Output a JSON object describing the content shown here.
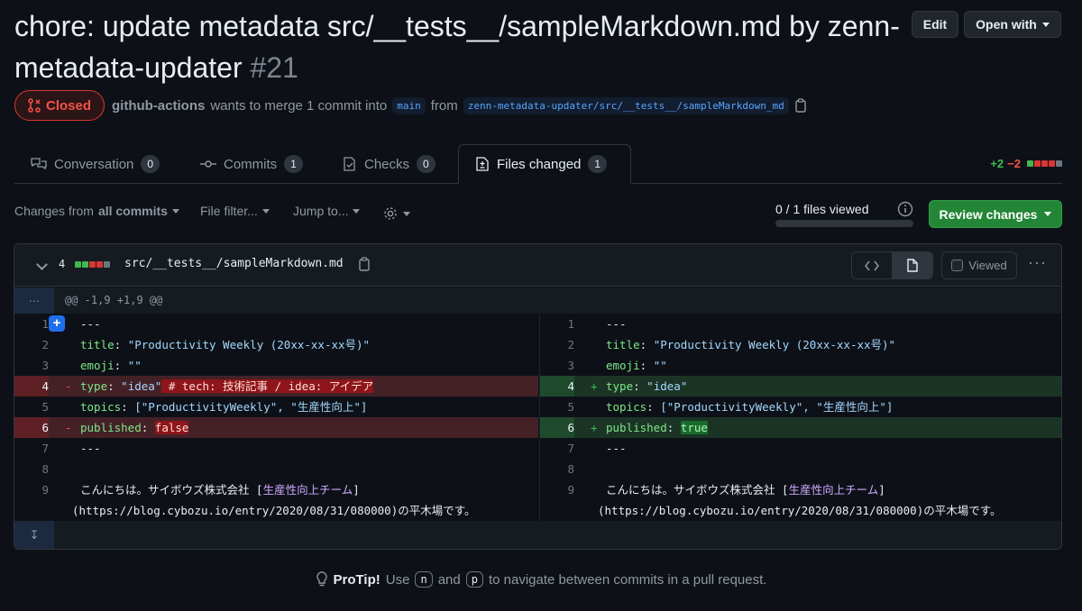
{
  "pr": {
    "title": "chore: update metadata src/__tests__/sampleMarkdown.md by zenn-metadata-updater",
    "number": "#21",
    "state": "Closed",
    "author": "github-actions",
    "merge_text": "wants to merge 1 commit into",
    "base_branch": "main",
    "from_text": "from",
    "head_branch": "zenn-metadata-updater/src/__tests__/sampleMarkdown_md"
  },
  "header_buttons": {
    "edit": "Edit",
    "open_with": "Open with"
  },
  "tabs": [
    {
      "label": "Conversation",
      "count": "0"
    },
    {
      "label": "Commits",
      "count": "1"
    },
    {
      "label": "Checks",
      "count": "0"
    },
    {
      "label": "Files changed",
      "count": "1"
    }
  ],
  "diffstat": {
    "additions": "+2",
    "deletions": "−2",
    "squares": [
      "green",
      "red",
      "red",
      "red",
      "grey"
    ]
  },
  "toolbar": {
    "changes_from_prefix": "Changes from",
    "changes_from_value": "all commits",
    "file_filter": "File filter...",
    "jump_to": "Jump to...",
    "viewed_count": "0 / 1 files viewed",
    "viewed_fraction": 0,
    "review_button": "Review changes"
  },
  "file": {
    "change_count": "4",
    "squares": [
      "green",
      "green",
      "red",
      "red",
      "grey"
    ],
    "path": "src/__tests__/sampleMarkdown.md",
    "viewed_label": "Viewed",
    "hunk_header": "@@ -1,9 +1,9 @@"
  },
  "diff": {
    "left": [
      {
        "ln": "1",
        "prefix": " ",
        "text": "---"
      },
      {
        "ln": "2",
        "prefix": " ",
        "key": "title",
        "value": "\"Productivity Weekly (20xx-xx-xx号)\""
      },
      {
        "ln": "3",
        "prefix": " ",
        "key": "emoji",
        "value": "\"\""
      },
      {
        "ln": "4",
        "prefix": "-",
        "key": "type",
        "value": "\"idea\"",
        "extra": " # tech: 技術記事 / idea: アイデア"
      },
      {
        "ln": "5",
        "prefix": " ",
        "key": "topics",
        "value": "[\"ProductivityWeekly\", \"生産性向上\"]"
      },
      {
        "ln": "6",
        "prefix": "-",
        "key": "published",
        "value": "false"
      },
      {
        "ln": "7",
        "prefix": " ",
        "text": "---"
      },
      {
        "ln": "8",
        "prefix": " ",
        "text": ""
      },
      {
        "ln": "9",
        "prefix": " ",
        "text": "こんにちは。サイボウズ株式会社 [",
        "link": "生産性向上チーム",
        "after": "]"
      },
      {
        "ln": "",
        "prefix": "",
        "text": "(https://blog.cybozu.io/entry/2020/08/31/080000)の平木場です。"
      }
    ],
    "right": [
      {
        "ln": "1",
        "prefix": " ",
        "text": "---"
      },
      {
        "ln": "2",
        "prefix": " ",
        "key": "title",
        "value": "\"Productivity Weekly (20xx-xx-xx号)\""
      },
      {
        "ln": "3",
        "prefix": " ",
        "key": "emoji",
        "value": "\"\""
      },
      {
        "ln": "4",
        "prefix": "+",
        "key": "type",
        "value": "\"idea\""
      },
      {
        "ln": "5",
        "prefix": " ",
        "key": "topics",
        "value": "[\"ProductivityWeekly\", \"生産性向上\"]"
      },
      {
        "ln": "6",
        "prefix": "+",
        "key": "published",
        "value": "true"
      },
      {
        "ln": "7",
        "prefix": " ",
        "text": "---"
      },
      {
        "ln": "8",
        "prefix": " ",
        "text": ""
      },
      {
        "ln": "9",
        "prefix": " ",
        "text": "こんにちは。サイボウズ株式会社 [",
        "link": "生産性向上チーム",
        "after": "]"
      },
      {
        "ln": "",
        "prefix": "",
        "text": "(https://blog.cybozu.io/entry/2020/08/31/080000)の平木場です。"
      }
    ]
  },
  "protip": {
    "label": "ProTip!",
    "use": "Use",
    "key1": "n",
    "and": "and",
    "key2": "p",
    "rest": "to navigate between commits in a pull request."
  },
  "colors": {
    "closed": "#f85149",
    "add": "#3fb950",
    "del": "#f85149",
    "accent": "#238636"
  }
}
